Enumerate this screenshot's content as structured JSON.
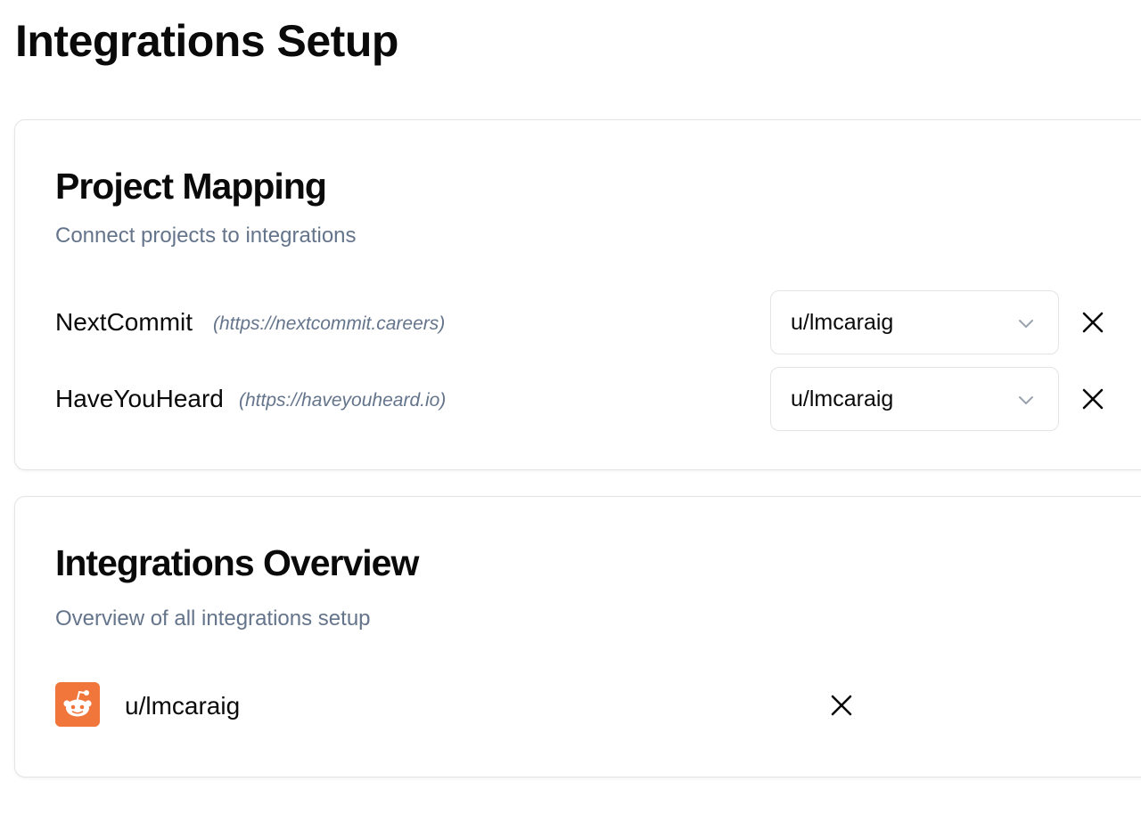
{
  "page": {
    "title": "Integrations Setup"
  },
  "project_mapping": {
    "title": "Project Mapping",
    "subtitle": "Connect projects to integrations",
    "rows": [
      {
        "name": "NextCommit",
        "url": "(https://nextcommit.careers)",
        "selected_integration": "u/lmcaraig",
        "select_icon": "chevron-down-icon",
        "remove_icon": "close-icon"
      },
      {
        "name": "HaveYouHeard",
        "url": "(https://haveyouheard.io)",
        "selected_integration": "u/lmcaraig",
        "select_icon": "chevron-down-icon",
        "remove_icon": "close-icon"
      }
    ]
  },
  "integrations_overview": {
    "title": "Integrations Overview",
    "subtitle": "Overview of all integrations setup",
    "items": [
      {
        "icon": "reddit-icon",
        "name": "u/lmcaraig",
        "remove_icon": "close-icon"
      }
    ]
  },
  "colors": {
    "muted_text": "#64748b",
    "border": "#e4e4e7",
    "reddit_brand": "#f0763c",
    "text": "#0a0a0a"
  }
}
